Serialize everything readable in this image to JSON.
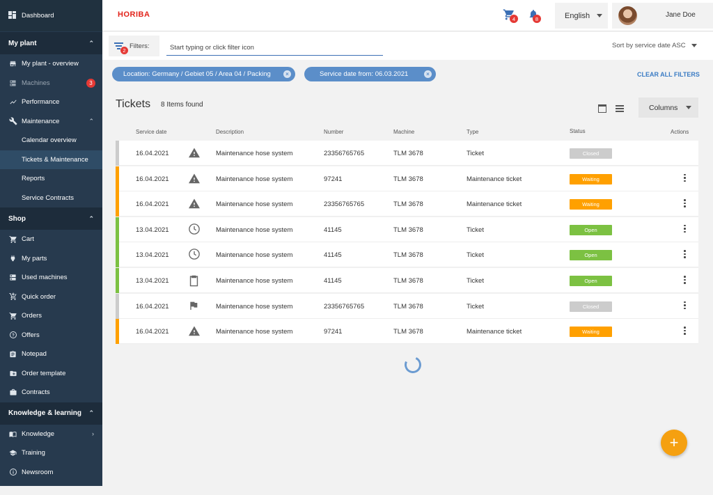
{
  "sidebar": {
    "dashboard": "Dashboard",
    "sections": {
      "my_plant": "My plant",
      "shop": "Shop",
      "knowledge": "Knowledge & learning"
    },
    "my_plant_items": [
      {
        "label": "My plant - overview",
        "icon": "store-icon"
      },
      {
        "label": "Machines",
        "icon": "server-icon",
        "badge": "3"
      },
      {
        "label": "Performance",
        "icon": "trending-icon"
      },
      {
        "label": "Maintenance",
        "icon": "wrench-icon"
      }
    ],
    "maintenance_sub": [
      "Calendar overview",
      "Tickets & Maintenance",
      "Reports",
      "Service Contracts"
    ],
    "shop_items": [
      {
        "label": "Cart",
        "icon": "cart-icon"
      },
      {
        "label": "My parts",
        "icon": "plug-icon"
      },
      {
        "label": "Used machines",
        "icon": "server-icon"
      },
      {
        "label": "Quick order",
        "icon": "cart-plus-icon"
      },
      {
        "label": "Orders",
        "icon": "cart-icon"
      },
      {
        "label": "Offers",
        "icon": "help-icon"
      },
      {
        "label": "Notepad",
        "icon": "clipboard-icon"
      },
      {
        "label": "Order template",
        "icon": "folder-icon"
      },
      {
        "label": "Contracts",
        "icon": "briefcase-icon"
      }
    ],
    "knowledge_items": [
      {
        "label": "Knowledge",
        "icon": "book-icon"
      },
      {
        "label": "Training",
        "icon": "school-icon"
      },
      {
        "label": "Newsroom",
        "icon": "info-icon"
      }
    ]
  },
  "topbar": {
    "logo": "HORIBA",
    "cart_badge": "4",
    "bell_badge": "8",
    "language": "English",
    "user_name": "Jane Doe"
  },
  "filters": {
    "label": "Filters:",
    "badge": "2",
    "placeholder": "Start typing or click filter icon",
    "sort": "Sort by service date ASC",
    "chips": [
      "Location: Germany / Gebiet 05 / Area 04 / Packing",
      "Service date from: 06.03.2021"
    ],
    "clear_all": "CLEAR ALL FILTERS"
  },
  "tickets": {
    "title": "Tickets",
    "count": "8 Items found",
    "columns_button": "Columns",
    "headers": {
      "service_date": "Service date",
      "description": "Description",
      "number": "Number",
      "machine": "Machine",
      "type": "Type",
      "status": "Status",
      "actions": "Actions"
    },
    "rows": [
      {
        "date": "16.04.2021",
        "icon": "warning-icon",
        "description": "Maintenance hose system",
        "number": "23356765765",
        "machine": "TLM 3678",
        "type": "Ticket",
        "status": "Closed",
        "actions": false
      },
      {
        "date": "16.04.2021",
        "icon": "warning-icon",
        "description": "Maintenance hose system",
        "number": "97241",
        "machine": "TLM 3678",
        "type": "Maintenance ticket",
        "status": "Waiting",
        "actions": true
      },
      {
        "date": "16.04.2021",
        "icon": "warning-icon",
        "description": "Maintenance hose system",
        "number": "23356765765",
        "machine": "TLM 3678",
        "type": "Maintenance ticket",
        "status": "Waiting",
        "actions": true
      },
      {
        "date": "13.04.2021",
        "icon": "clock-icon",
        "description": "Maintenance hose system",
        "number": "41145",
        "machine": "TLM 3678",
        "type": "Ticket",
        "status": "Open",
        "actions": true
      },
      {
        "date": "13.04.2021",
        "icon": "clock-icon",
        "description": "Maintenance hose system",
        "number": "41145",
        "machine": "TLM 3678",
        "type": "Ticket",
        "status": "Open",
        "actions": true
      },
      {
        "date": "13.04.2021",
        "icon": "clipboard-icon",
        "description": "Maintenance hose system",
        "number": "41145",
        "machine": "TLM 3678",
        "type": "Ticket",
        "status": "Open",
        "actions": true
      },
      {
        "date": "16.04.2021",
        "icon": "flag-icon",
        "description": "Maintenance hose system",
        "number": "23356765765",
        "machine": "TLM 3678",
        "type": "Ticket",
        "status": "Closed",
        "actions": true
      },
      {
        "date": "16.04.2021",
        "icon": "warning-icon",
        "description": "Maintenance hose system",
        "number": "97241",
        "machine": "TLM 3678",
        "type": "Maintenance ticket",
        "status": "Waiting",
        "actions": true
      }
    ]
  },
  "colors": {
    "Closed": "#cccccc",
    "Waiting": "#ffa000",
    "Open": "#7cc142",
    "accent": "#3b6fb5",
    "fab": "#f5a010"
  }
}
